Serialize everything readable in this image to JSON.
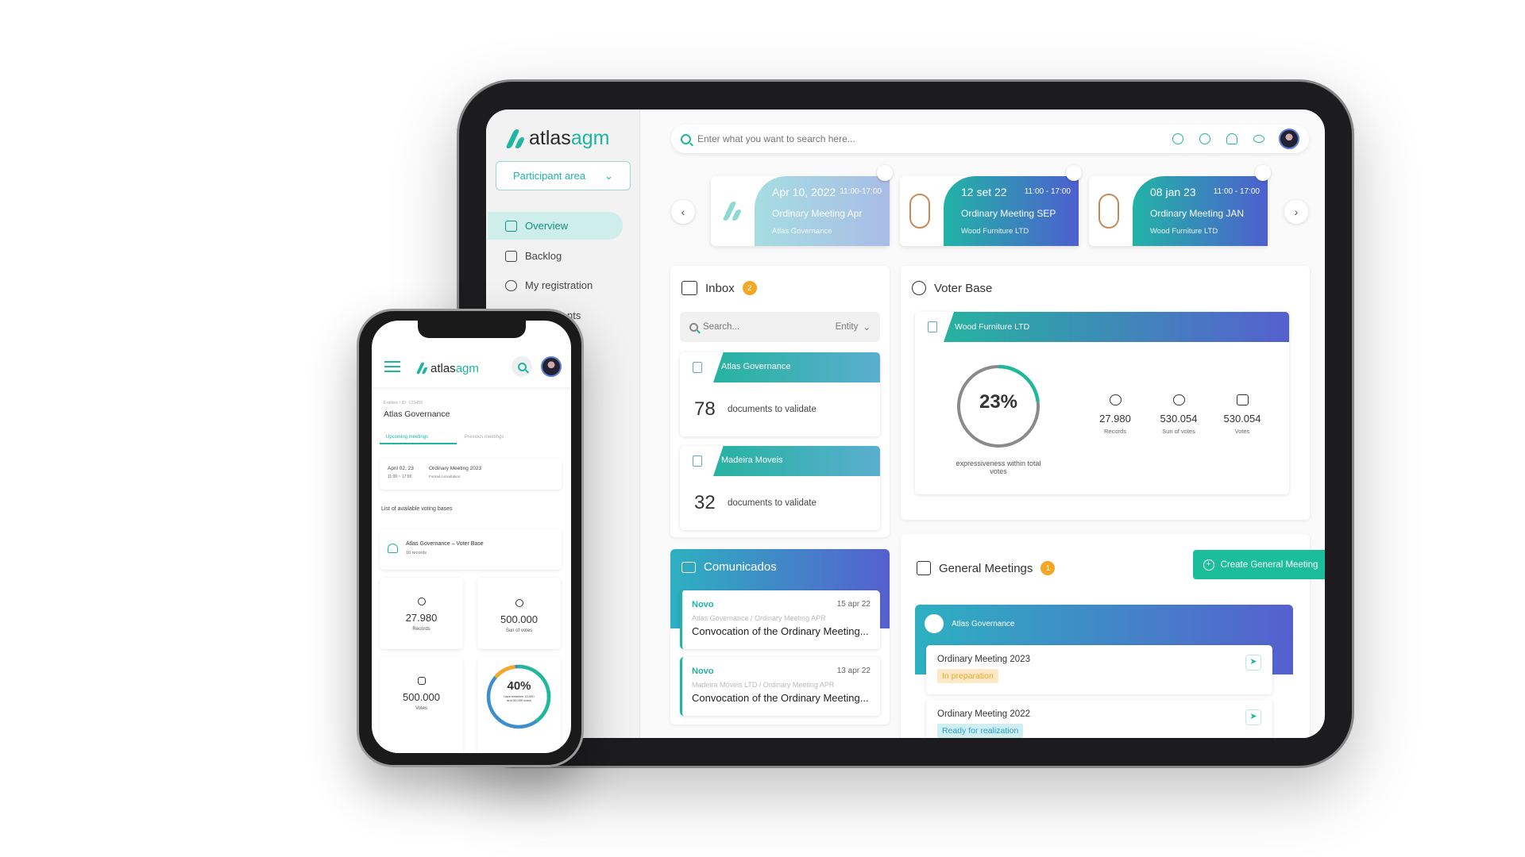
{
  "brand": {
    "name_a": "atlas",
    "name_b": "agm",
    "accent": "#1fb5a3"
  },
  "sidebar": {
    "area_select": "Participant area",
    "items": [
      {
        "label": "Overview",
        "icon": "home-icon",
        "active": true
      },
      {
        "label": "Backlog",
        "icon": "inbox-download-icon"
      },
      {
        "label": "My registration",
        "icon": "user-icon"
      },
      {
        "label": "nts",
        "icon": ""
      }
    ]
  },
  "search": {
    "placeholder": "Enter what you want to search here..."
  },
  "top_icons": [
    "chat-icon",
    "help-icon",
    "bell-icon",
    "eye-icon"
  ],
  "meetings": [
    {
      "date": "Apr 10, 2022",
      "time": "11:00-17:00",
      "name": "Ordinary Meeting Apr",
      "org": "Atlas Governance"
    },
    {
      "date": "12 set 22",
      "time": "11:00 - 17:00",
      "name": "Ordinary Meeting SEP",
      "org": "Wood Furniture LTD"
    },
    {
      "date": "08 jan 23",
      "time": "11:00 - 17:00",
      "name": "Ordinary Meeting JAN",
      "org": "Wood Furniture LTD"
    }
  ],
  "inbox": {
    "title": "Inbox",
    "badge": "2",
    "search_placeholder": "Search...",
    "filter": "Entity",
    "items": [
      {
        "org": "Atlas Governance",
        "count": "78",
        "text": "documents to validate"
      },
      {
        "org": "Madeira Moveis",
        "count": "32",
        "text": "documents to validate"
      }
    ]
  },
  "voter_base": {
    "title": "Voter Base",
    "org": "Wood Furniture LTD",
    "percent": "23%",
    "percent_value": 23,
    "percent_label": "expressiveness within total votes",
    "stats": [
      {
        "value": "27.980",
        "label": "Records"
      },
      {
        "value": "530.054",
        "label": "Sun of votes"
      },
      {
        "value": "530.054",
        "label": "Votes"
      }
    ]
  },
  "comunicados": {
    "title": "Comunicados",
    "items": [
      {
        "tag": "Novo",
        "date": "15 apr 22",
        "source": "Atlas Governance / Ordinary Meeting APR",
        "title": "Convocation of the Ordinary Meeting..."
      },
      {
        "tag": "Novo",
        "date": "13 apr 22",
        "source": "Madeira Móveis LTD / Ordinary Meeting APR",
        "title": "Convocation of the Ordinary Meeting..."
      }
    ]
  },
  "general_meetings": {
    "title": "General Meetings",
    "badge": "1",
    "create_label": "Create General Meeting",
    "org": "Atlas Governance",
    "items": [
      {
        "name": "Ordinary Meeting 2023",
        "status": "In preparation",
        "status_color": "#f5a623"
      },
      {
        "name": "Ordinary Meeting 2022",
        "status": "Ready for realization",
        "status_color": "#2a9fd0"
      }
    ]
  },
  "phone": {
    "breadcrumb_a": "Entities",
    "breadcrumb_b": "ID: 123456",
    "title": "Atlas Governance",
    "tabs": [
      "Upcoming meetings",
      "Previous meetings"
    ],
    "meeting": {
      "date": "April 02, 23",
      "time": "11:00 ~ 17:00",
      "name": "Ordinary Meeting 2023",
      "type": "Formal consultation"
    },
    "list_title": "List of available voting bases",
    "voter_base": {
      "name": "Atlas Governance – Voter Base",
      "records": "10 records"
    },
    "stats": [
      {
        "value": "27.980",
        "label": "Records"
      },
      {
        "value": "500.000",
        "label": "Sun of votes"
      },
      {
        "value": "500.000",
        "label": "Votes"
      }
    ],
    "donut": {
      "percent": "40%",
      "percent_value": 40,
      "label": "have between 10,000 and 50,000 votes"
    }
  }
}
